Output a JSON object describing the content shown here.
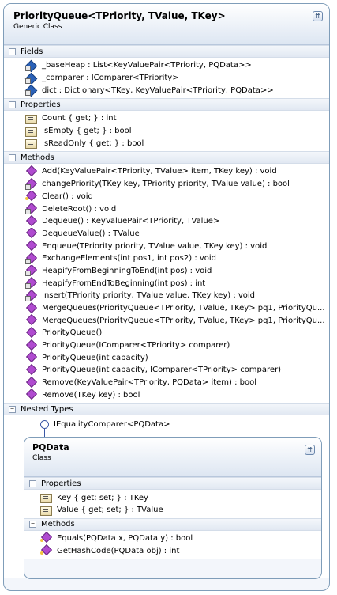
{
  "class": {
    "title": "PriorityQueue<TPriority, TValue, TKey>",
    "subtitle": "Generic Class",
    "collapse_glyph": "⇈"
  },
  "sections": {
    "fields": "Fields",
    "properties": "Properties",
    "methods": "Methods",
    "nested": "Nested Types"
  },
  "toggle_glyph": "−",
  "fields": [
    "_baseHeap : List<KeyValuePair<TPriority, PQData>>",
    "_comparer : IComparer<TPriority>",
    "dict : Dictionary<TKey, KeyValuePair<TPriority, PQData>>"
  ],
  "properties": [
    "Count { get; } : int",
    "IsEmpty { get; } : bool",
    "IsReadOnly { get; } : bool"
  ],
  "methods": [
    "Add(KeyValuePair<TPriority, TValue> item, TKey key) : void",
    "changePriority(TKey key, TPriority priority, TValue value) : bool",
    "Clear() : void",
    "DeleteRoot() : void",
    "Dequeue() : KeyValuePair<TPriority, TValue>",
    "DequeueValue() : TValue",
    "Enqueue(TPriority priority, TValue value, TKey key) : void",
    "ExchangeElements(int pos1, int pos2) : void",
    "HeapifyFromBeginningToEnd(int pos) : void",
    "HeapifyFromEndToBeginning(int pos) : int",
    "Insert(TPriority priority, TValue value, TKey key) : void",
    "MergeQueues(PriorityQueue<TPriority, TValue, TKey> pq1, PriorityQu...",
    "MergeQueues(PriorityQueue<TPriority, TValue, TKey> pq1, PriorityQu...",
    "PriorityQueue()",
    "PriorityQueue(IComparer<TPriority> comparer)",
    "PriorityQueue(int capacity)",
    "PriorityQueue(int capacity, IComparer<TPriority> comparer)",
    "Remove(KeyValuePair<TPriority, PQData> item) : bool",
    "Remove(TKey key) : bool"
  ],
  "interface_label": "IEqualityComparer<PQData>",
  "nested_class": {
    "title": "PQData",
    "subtitle": "Class",
    "collapse_glyph": "⇈",
    "properties": [
      "Key { get; set; } : TKey",
      "Value { get; set; } : TValue"
    ],
    "methods": [
      "Equals(PQData x, PQData y) : bool",
      "GetHashCode(PQData obj) : int"
    ]
  }
}
